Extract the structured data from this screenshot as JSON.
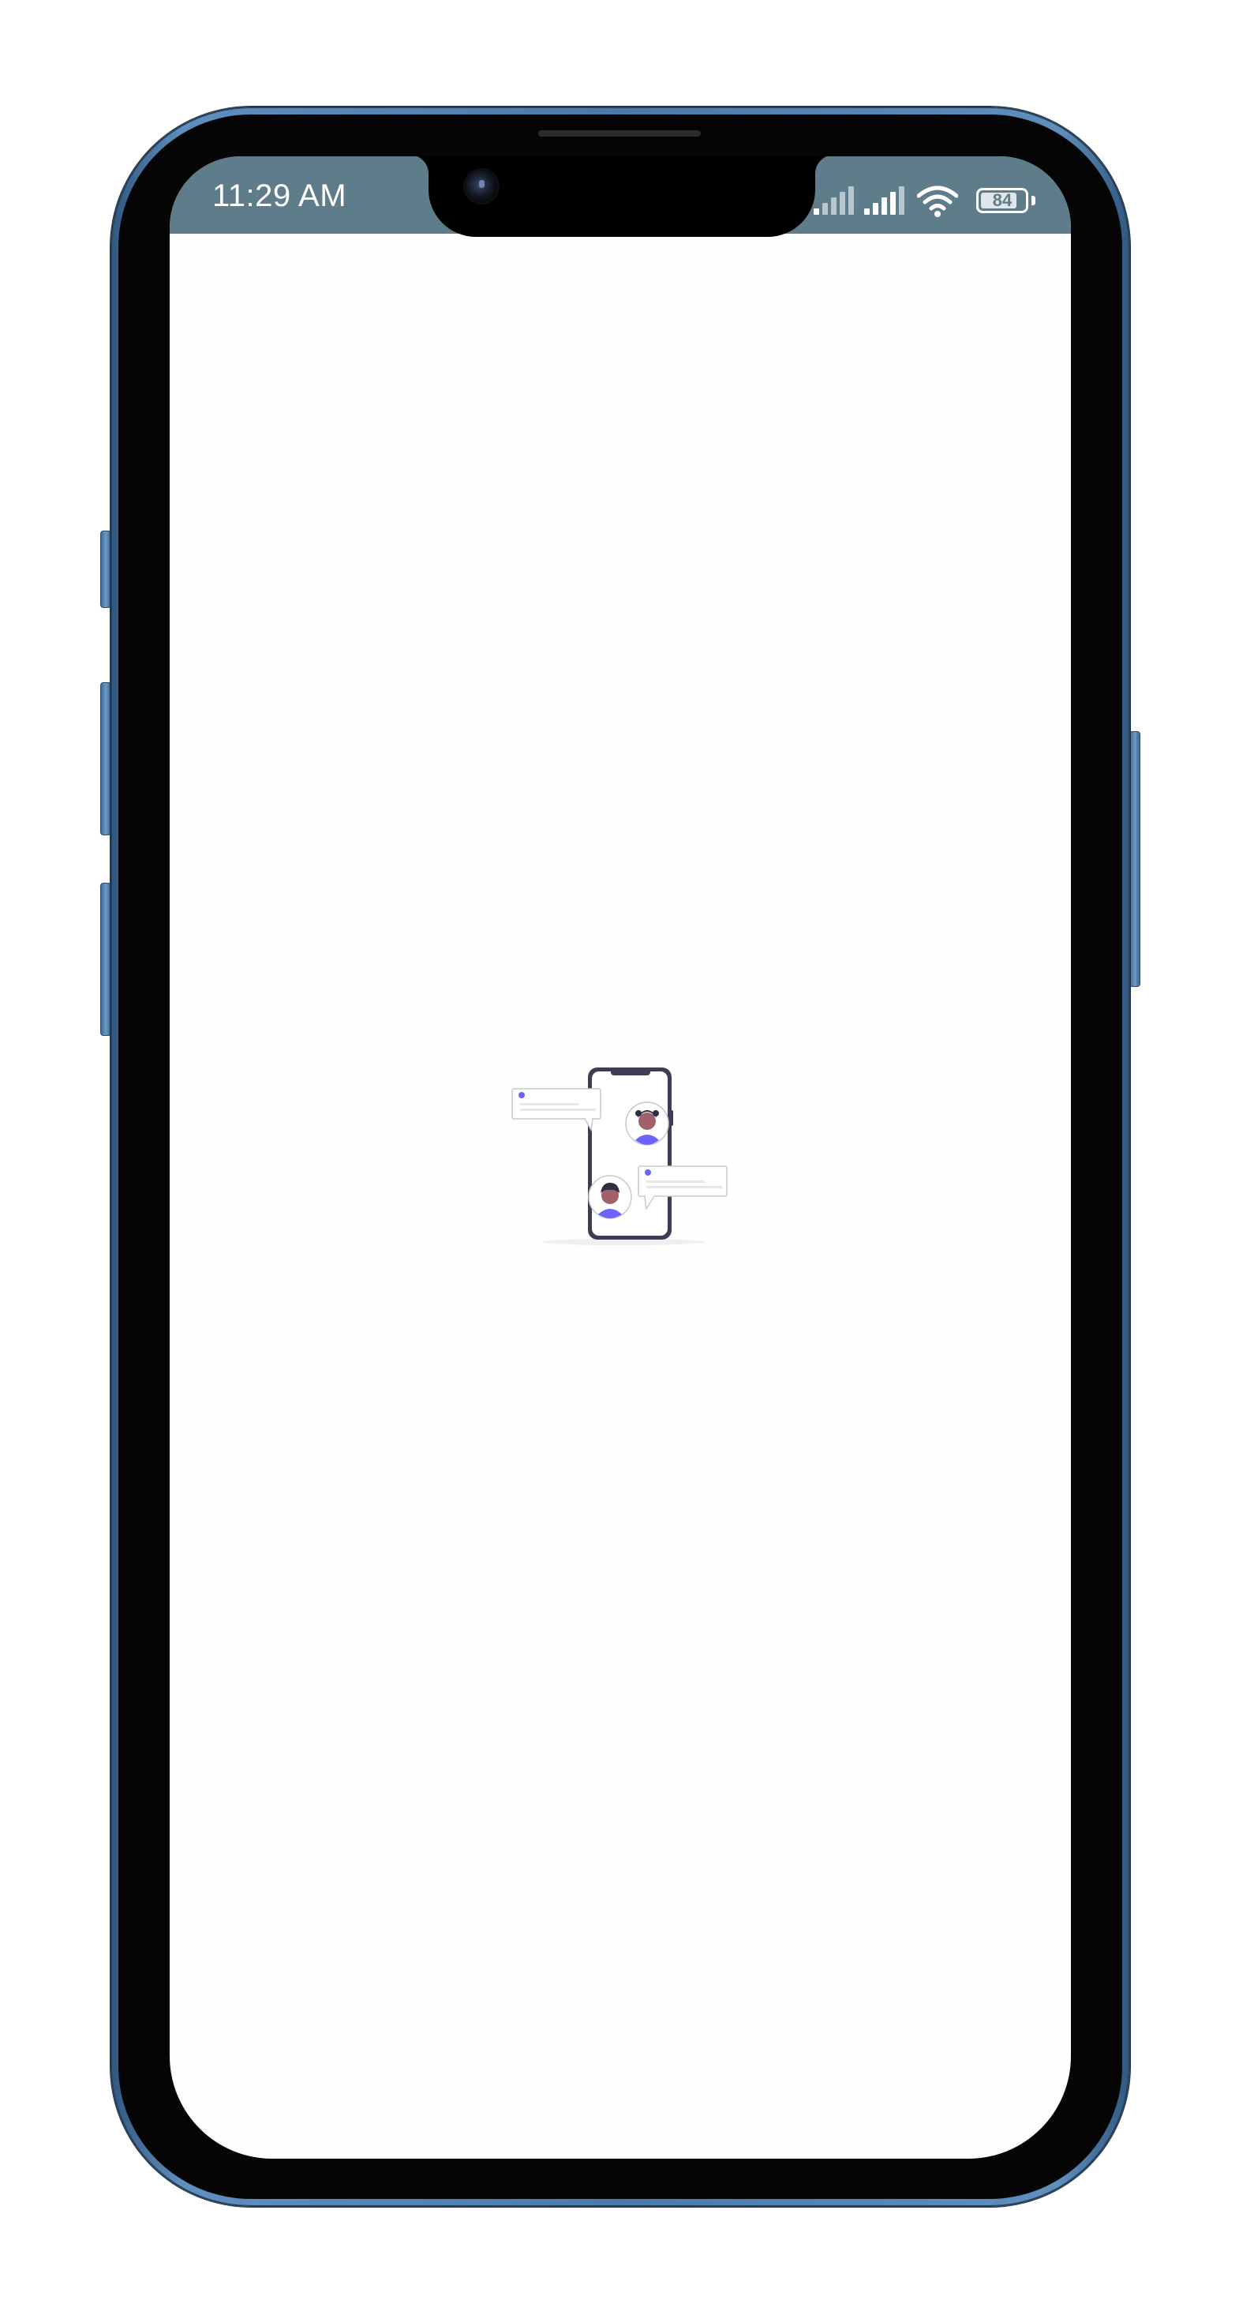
{
  "status_bar": {
    "time": "11:29 AM",
    "battery_percent": "84",
    "battery_level": 0.84,
    "background_color": "#5f7c8b",
    "icons": [
      "cellular-signal-1-icon",
      "cellular-signal-2-icon",
      "wifi-icon",
      "battery-icon"
    ]
  },
  "device": {
    "frame_color": "#4b7aa9"
  },
  "splash": {
    "illustration": "chat-messaging-illustration",
    "accent_color": "#6c63ff"
  }
}
